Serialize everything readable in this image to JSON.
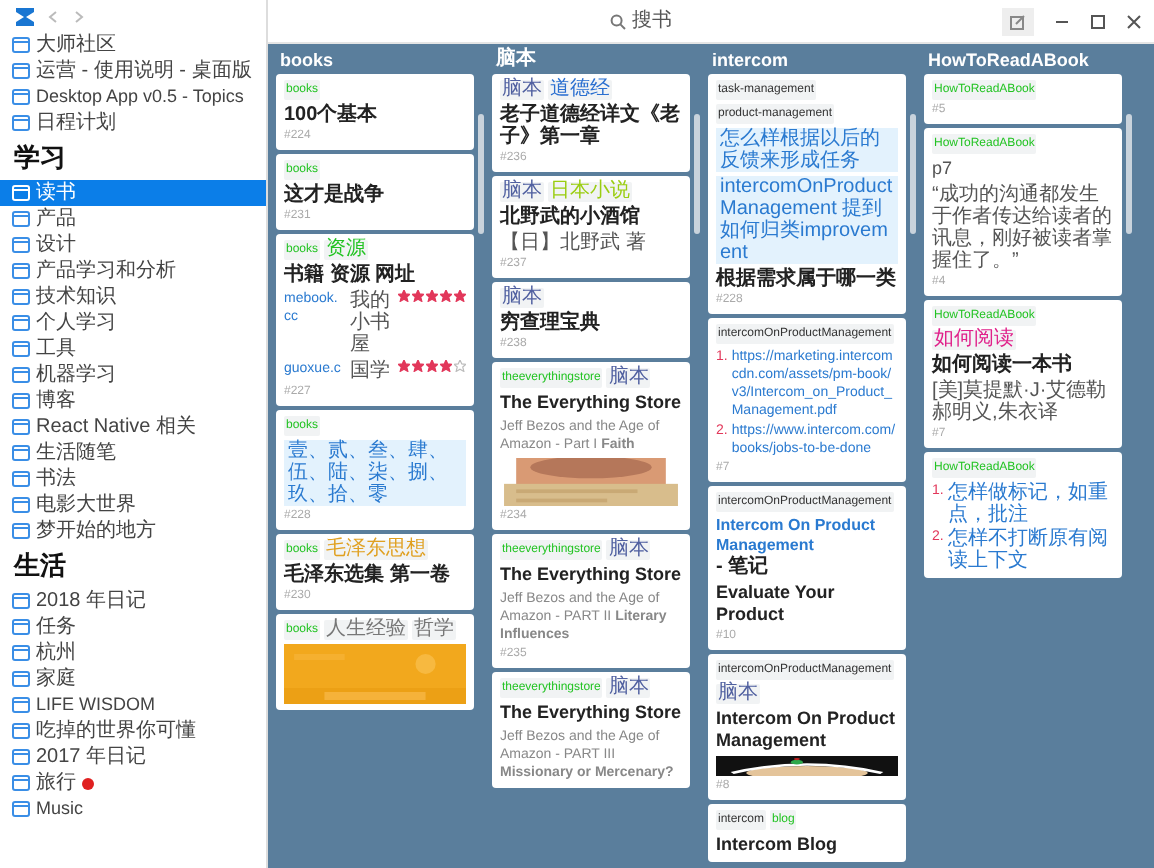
{
  "toolbar": {
    "search_placeholder": "搜书"
  },
  "sidebar": {
    "sections": [
      {
        "items": [
          {
            "label": "大师社区",
            "selected": false,
            "marked": false
          },
          {
            "label": "运营 - 使用说明 - 桌面版",
            "selected": false,
            "marked": false
          },
          {
            "label": "Desktop App v0.5 - Topics",
            "selected": false,
            "marked": false
          },
          {
            "label": "日程计划",
            "selected": false,
            "marked": false
          }
        ]
      },
      {
        "heading": "学习",
        "items": [
          {
            "label": "读书",
            "selected": true,
            "marked": false
          },
          {
            "label": "产品",
            "selected": false,
            "marked": false
          },
          {
            "label": "设计",
            "selected": false,
            "marked": false
          },
          {
            "label": "产品学习和分析",
            "selected": false,
            "marked": false
          },
          {
            "label": "技术知识",
            "selected": false,
            "marked": false
          },
          {
            "label": "个人学习",
            "selected": false,
            "marked": false
          },
          {
            "label": "工具",
            "selected": false,
            "marked": false
          },
          {
            "label": "机器学习",
            "selected": false,
            "marked": false
          },
          {
            "label": "博客",
            "selected": false,
            "marked": false
          },
          {
            "label": "React Native 相关",
            "selected": false,
            "marked": false
          },
          {
            "label": "生活随笔",
            "selected": false,
            "marked": false
          },
          {
            "label": "书法",
            "selected": false,
            "marked": false
          },
          {
            "label": "电影大世界",
            "selected": false,
            "marked": false
          },
          {
            "label": "梦开始的地方",
            "selected": false,
            "marked": false
          }
        ]
      },
      {
        "heading": "生活",
        "items": [
          {
            "label": "2018 年日记",
            "selected": false,
            "marked": false
          },
          {
            "label": "任务",
            "selected": false,
            "marked": false
          },
          {
            "label": "杭州",
            "selected": false,
            "marked": false
          },
          {
            "label": "家庭",
            "selected": false,
            "marked": false
          },
          {
            "label": "LIFE WISDOM",
            "selected": false,
            "marked": false
          },
          {
            "label": "吃掉的世界你可懂",
            "selected": false,
            "marked": false
          },
          {
            "label": "2017 年日记",
            "selected": false,
            "marked": false
          },
          {
            "label": "旅行",
            "selected": false,
            "marked": true
          },
          {
            "label": "Music",
            "selected": false,
            "marked": false
          }
        ]
      }
    ]
  },
  "columns": [
    {
      "title": "books",
      "cards": [
        {
          "tags": [
            {
              "label": "books",
              "color": "#22c322"
            }
          ],
          "blocks": [
            {
              "kind": "title",
              "text": "100个基本"
            }
          ],
          "id": "#224"
        },
        {
          "tags": [
            {
              "label": "books",
              "color": "#22c322"
            }
          ],
          "blocks": [
            {
              "kind": "title",
              "text": "这才是战争"
            }
          ],
          "id": "#231"
        },
        {
          "tags": [
            {
              "label": "books",
              "color": "#22c322"
            },
            {
              "label": "资源",
              "color": "#22c322"
            }
          ],
          "blocks": [
            {
              "kind": "title",
              "text": "书籍 资源 网址"
            },
            {
              "kind": "table",
              "rows": [
                {
                  "link": "mebook.cc",
                  "name": "我的小书屋",
                  "stars": 5
                },
                {
                  "link": "guoxue.c",
                  "name": "国学",
                  "stars": 4
                }
              ]
            }
          ],
          "id": "#227"
        },
        {
          "tags": [
            {
              "label": "books",
              "color": "#22c322"
            }
          ],
          "blocks": [
            {
              "kind": "highlight",
              "text": "壹、贰、叁、肆、伍、陆、柒、捌、玖、拾、零"
            }
          ],
          "id": "#228"
        },
        {
          "tags": [
            {
              "label": "books",
              "color": "#22c322"
            },
            {
              "label": "毛泽东思想",
              "color": "#e0a020"
            }
          ],
          "blocks": [
            {
              "kind": "title",
              "text": "毛泽东选集 第一卷"
            }
          ],
          "id": "#230"
        },
        {
          "tags": [
            {
              "label": "books",
              "color": "#22c322"
            },
            {
              "label": "人生经验",
              "color": "#777777"
            },
            {
              "label": "哲学",
              "color": "#777777"
            }
          ],
          "blocks": [
            {
              "kind": "picture"
            }
          ]
        }
      ]
    },
    {
      "title": "脑本",
      "cards": [
        {
          "tags": [
            {
              "label": "脑本",
              "color": "#5060a0"
            },
            {
              "label": "道德经",
              "color": "#2a6fd0"
            }
          ],
          "blocks": [
            {
              "kind": "title",
              "text": "老子道德经详文《老子》第一章"
            }
          ],
          "id": "#236"
        },
        {
          "tags": [
            {
              "label": "脑本",
              "color": "#5060a0"
            },
            {
              "label": "日本小说",
              "color": "#9acd10"
            }
          ],
          "blocks": [
            {
              "kind": "title",
              "text": "北野武的小酒馆"
            },
            {
              "kind": "text",
              "text": "【日】北野武 著"
            }
          ],
          "id": "#237"
        },
        {
          "tags": [
            {
              "label": "脑本",
              "color": "#5060a0"
            }
          ],
          "blocks": [
            {
              "kind": "title",
              "text": "穷查理宝典"
            }
          ],
          "id": "#238"
        },
        {
          "tags": [
            {
              "label": "theeverythingstore",
              "color": "#22c322"
            },
            {
              "label": "脑本",
              "color": "#5060a0"
            }
          ],
          "blocks": [
            {
              "kind": "title",
              "text": "The Everything Store"
            },
            {
              "kind": "subtitle",
              "text": "Jeff Bezos and the Age of Amazon - Part I **Faith**"
            },
            {
              "kind": "picture"
            }
          ],
          "id": "#234"
        },
        {
          "tags": [
            {
              "label": "theeverythingstore",
              "color": "#22c322"
            },
            {
              "label": "脑本",
              "color": "#5060a0"
            }
          ],
          "blocks": [
            {
              "kind": "title",
              "text": "The Everything Store"
            },
            {
              "kind": "subtitle",
              "text": "Jeff Bezos and the Age of Amazon - PART II **Literary Influences**"
            }
          ],
          "id": "#235"
        },
        {
          "tags": [
            {
              "label": "theeverythingstore",
              "color": "#22c322"
            },
            {
              "label": "脑本",
              "color": "#5060a0"
            }
          ],
          "blocks": [
            {
              "kind": "title",
              "text": "The Everything Store"
            },
            {
              "kind": "subtitle",
              "text": "Jeff Bezos and the Age of Amazon - PART III **Missionary or Mercenary?**"
            }
          ]
        }
      ]
    },
    {
      "title": "intercom",
      "cards": [
        {
          "tags": [
            {
              "label": "task-management",
              "color": "#333333"
            },
            {
              "label": "product-management",
              "color": "#333333"
            }
          ],
          "blocks": [
            {
              "kind": "highlight",
              "text": "怎么样根据以后的反馈来形成任务"
            },
            {
              "kind": "highlight",
              "text": "intercomOnProductManagement 提到如何归类improvement"
            },
            {
              "kind": "bold",
              "text": "根据需求属于哪一类"
            }
          ],
          "id": "#228"
        },
        {
          "tags": [
            {
              "label": "intercomOnProductManagement",
              "color": "#333333"
            }
          ],
          "blocks": [
            {
              "kind": "links",
              "items": [
                {
                  "marker": "1.",
                  "text": "https://marketing.intercomcdn.com/assets/pm-book/v3/Intercom_on_Product_Management.pdf"
                },
                {
                  "marker": "2.",
                  "text": "https://www.intercom.com/books/jobs-to-be-done"
                }
              ]
            }
          ],
          "id": "#7"
        },
        {
          "tags": [
            {
              "label": "intercomOnProductManagement",
              "color": "#333333"
            }
          ],
          "blocks": [
            {
              "kind": "title_link",
              "link": "Intercom On Product Management",
              "text": " - 笔记"
            },
            {
              "kind": "title",
              "text": "Evaluate Your Product"
            }
          ],
          "id": "#10"
        },
        {
          "tags": [
            {
              "label": "intercomOnProductManagement",
              "color": "#333333"
            },
            {
              "label": "脑本",
              "color": "#5060a0"
            }
          ],
          "blocks": [
            {
              "kind": "title",
              "text": "Intercom On Product Management"
            },
            {
              "kind": "picture"
            }
          ],
          "id": "#8"
        },
        {
          "tags": [
            {
              "label": "intercom",
              "color": "#333333"
            },
            {
              "label": "blog",
              "color": "#22c322"
            }
          ],
          "blocks": [
            {
              "kind": "title",
              "text": "Intercom Blog"
            }
          ]
        }
      ]
    },
    {
      "title": "HowToReadABook",
      "cards": [
        {
          "tags": [
            {
              "label": "HowToReadABook",
              "color": "#22c322"
            }
          ],
          "id": "#5"
        },
        {
          "tags": [
            {
              "label": "HowToReadABook",
              "color": "#22c322"
            }
          ],
          "blocks": [
            {
              "kind": "text",
              "text": "p7"
            },
            {
              "kind": "text",
              "text": "“成功的沟通都发生于作者传达给读者的讯息，刚好被读者掌握住了。”"
            }
          ],
          "id": "#4"
        },
        {
          "tags": [
            {
              "label": "HowToReadABook",
              "color": "#22c322"
            },
            {
              "label": "如何阅读",
              "color": "#e0208a"
            }
          ],
          "blocks": [
            {
              "kind": "title",
              "text": "如何阅读一本书"
            },
            {
              "kind": "text",
              "text": "[美]莫提默·J·艾德勒郝明义,朱衣译"
            }
          ],
          "id": "#7"
        },
        {
          "tags": [
            {
              "label": "HowToReadABook",
              "color": "#22c322"
            }
          ],
          "blocks": [
            {
              "kind": "links",
              "items": [
                {
                  "marker": "1.",
                  "text": "怎样做标记，如重点，批注"
                },
                {
                  "marker": "2.",
                  "text": "怎样不打断原有阅读上下文"
                }
              ]
            }
          ]
        }
      ]
    }
  ]
}
